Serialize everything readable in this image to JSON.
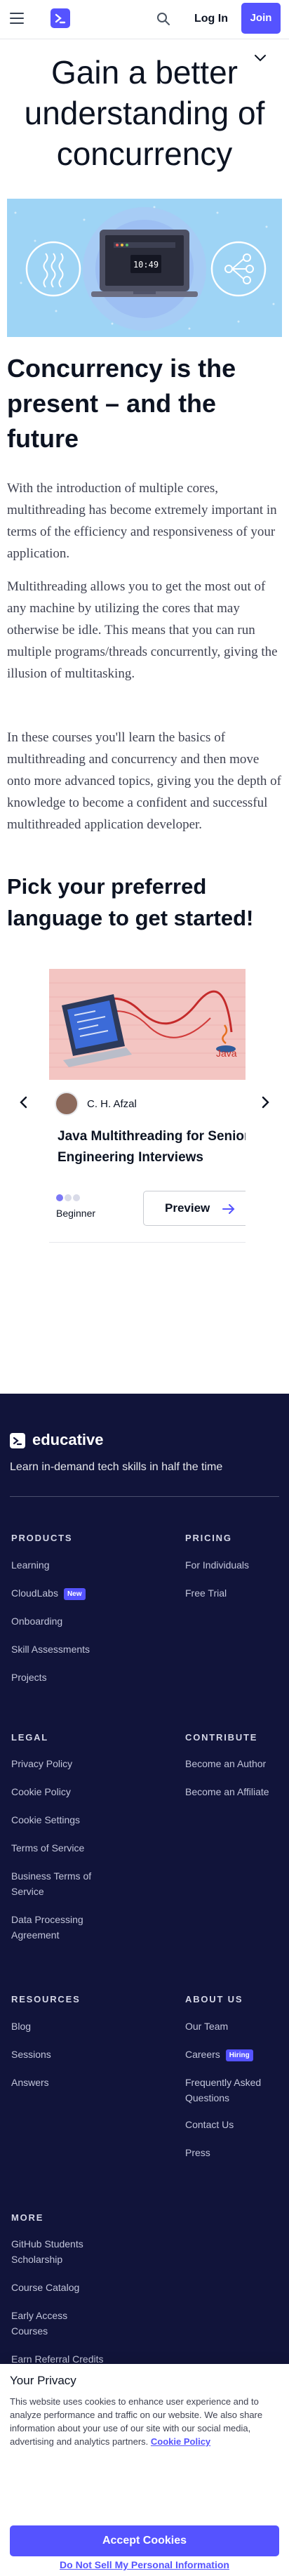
{
  "nav": {
    "login_label": "Log In",
    "join_label": "Join",
    "colors": {
      "brand": "#5553ff"
    }
  },
  "hero": {
    "title": "Gain a better understanding of concurrency"
  },
  "banner": {
    "screen_text": "10:49"
  },
  "content": {
    "section_title": "Concurrency is the present – and the future",
    "paragraphs": [
      "With the introduction of multiple cores, multithreading has become extremely important in terms of the efficiency and responsiveness of your application.",
      "Multithreading allows you to get the most out of any machine by utilizing the cores that may otherwise be idle. This means that you can run multiple programs/threads concurrently, giving the illusion of multitasking.",
      "In these courses you'll learn the basics of multithreading and concurrency and then move onto more advanced topics, giving you the depth of knowledge to become a confident and successful multithreaded application developer."
    ],
    "pick_title": "Pick your preferred language to get started!"
  },
  "course_card": {
    "image_label": "Java",
    "author": "C. H. Afzal",
    "title": "Java Multithreading for Senior Engineering Interviews",
    "level": "Beginner",
    "level_filled": 1,
    "level_total": 3,
    "preview_label": "Preview"
  },
  "footer": {
    "brand": "educative",
    "tagline": "Learn in-demand tech skills in half the time",
    "products": {
      "heading": "PRODUCTS",
      "items": [
        "Learning",
        "CloudLabs",
        "Onboarding",
        "Skill Assessments",
        "Projects"
      ],
      "cloudlabs_badge": "New"
    },
    "pricing": {
      "heading": "PRICING",
      "items": [
        "For Individuals",
        "Free Trial"
      ]
    },
    "legal": {
      "heading": "LEGAL",
      "items": [
        "Privacy Policy",
        "Cookie Policy",
        "Cookie Settings",
        "Terms of Service",
        "Business Terms of Service",
        "Data Processing Agreement"
      ]
    },
    "contribute": {
      "heading": "CONTRIBUTE",
      "items": [
        "Become an Author",
        "Become an Affiliate"
      ]
    },
    "resources": {
      "heading": "RESOURCES",
      "items": [
        "Blog",
        "Sessions",
        "Answers"
      ]
    },
    "about": {
      "heading": "ABOUT US",
      "items": [
        "Our Team",
        "Careers",
        "Frequently Asked Questions",
        "Contact Us",
        "Press"
      ],
      "careers_badge": "Hiring"
    },
    "more": {
      "heading": "MORE",
      "items": [
        "GitHub Students Scholarship",
        "Course Catalog",
        "Early Access Courses",
        "Earn Referral Credits"
      ]
    },
    "colors": {
      "background": "#11143a"
    }
  },
  "cookie_banner": {
    "title": "Your Privacy",
    "text": "This website uses cookies to enhance user experience and to analyze performance and traffic on our website. We also share information about your use of our site with our social media, advertising and analytics partners.",
    "policy_link": "Cookie Policy",
    "accept_label": "Accept Cookies",
    "do_not_sell_label": "Do Not Sell My Personal Information"
  }
}
